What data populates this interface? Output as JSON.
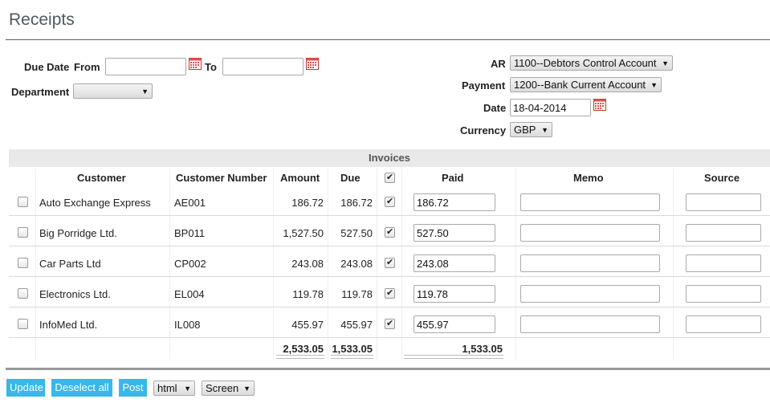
{
  "page": {
    "title": "Receipts"
  },
  "filters": {
    "due_date_label": "Due Date",
    "from_label": "From",
    "from_value": "",
    "to_label": "To",
    "to_value": "",
    "department_label": "Department",
    "department_value": ""
  },
  "account": {
    "ar_label": "AR",
    "ar_value": "1100--Debtors Control Account",
    "payment_label": "Payment",
    "payment_value": "1200--Bank Current Account",
    "date_label": "Date",
    "date_value": "18-04-2014",
    "currency_label": "Currency",
    "currency_value": "GBP"
  },
  "table": {
    "caption": "Invoices",
    "headers": {
      "customer": "Customer",
      "customer_number": "Customer Number",
      "amount": "Amount",
      "due": "Due",
      "paid": "Paid",
      "memo": "Memo",
      "source": "Source"
    },
    "header_checkbox_checked": true,
    "rows": [
      {
        "selected": false,
        "customer": "Auto Exchange Express",
        "number": "AE001",
        "amount": "186.72",
        "due": "186.72",
        "checked": true,
        "paid": "186.72",
        "memo": "",
        "source": ""
      },
      {
        "selected": false,
        "customer": "Big Porridge Ltd.",
        "number": "BP011",
        "amount": "1,527.50",
        "due": "527.50",
        "checked": true,
        "paid": "527.50",
        "memo": "",
        "source": ""
      },
      {
        "selected": false,
        "customer": "Car Parts Ltd",
        "number": "CP002",
        "amount": "243.08",
        "due": "243.08",
        "checked": true,
        "paid": "243.08",
        "memo": "",
        "source": ""
      },
      {
        "selected": false,
        "customer": "Electronics Ltd.",
        "number": "EL004",
        "amount": "119.78",
        "due": "119.78",
        "checked": true,
        "paid": "119.78",
        "memo": "",
        "source": ""
      },
      {
        "selected": false,
        "customer": "InfoMed Ltd.",
        "number": "IL008",
        "amount": "455.97",
        "due": "455.97",
        "checked": true,
        "paid": "455.97",
        "memo": "",
        "source": ""
      }
    ],
    "totals": {
      "amount": "2,533.05",
      "due": "1,533.05",
      "paid": "1,533.05"
    }
  },
  "footer": {
    "update_label": "Update",
    "deselect_label": "Deselect all",
    "post_label": "Post",
    "format_value": "html",
    "output_value": "Screen"
  },
  "icons": {
    "calendar": "calendar-icon",
    "dropdown": "chevron-down-icon"
  },
  "colors": {
    "button_bg": "#38b7e8",
    "invoices_bar": "#e9e9e9",
    "title": "#4e5a5e"
  }
}
